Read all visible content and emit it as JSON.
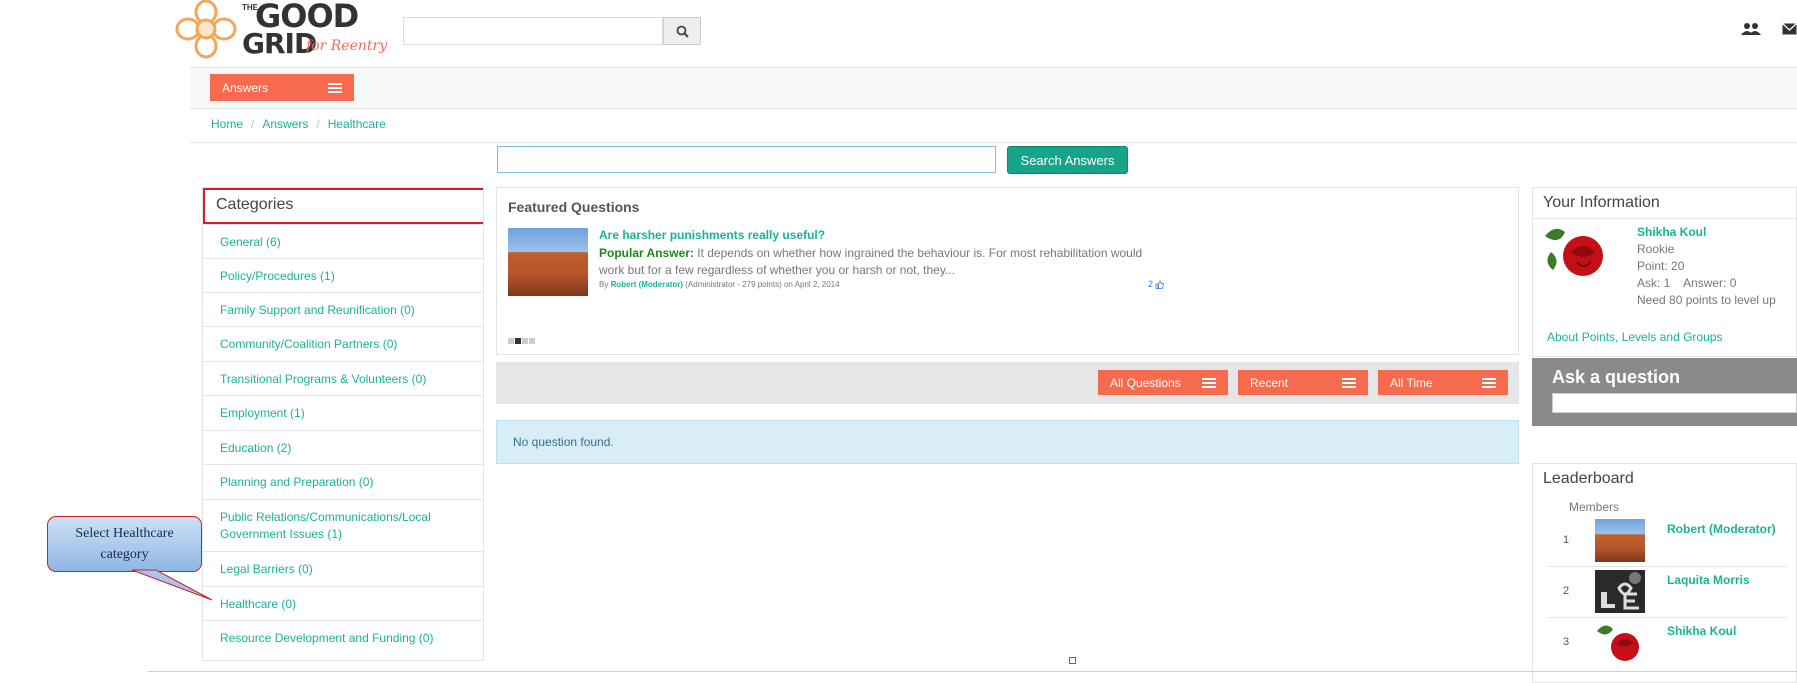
{
  "header": {
    "logo_line1": "GOOD",
    "logo_line2": "GRID",
    "logo_the": "THE",
    "logo_tagline": "for Reentry",
    "search_placeholder": "",
    "search_icon": "search-icon",
    "members_icon": "users-icon",
    "mail_icon": "envelope-icon"
  },
  "answers_menu": {
    "label": "Answers"
  },
  "breadcrumb": [
    "Home",
    "Answers",
    "Healthcare"
  ],
  "main_search": {
    "placeholder": "",
    "button_label": "Search Answers"
  },
  "categories": {
    "title": "Categories",
    "items": [
      "General (6)",
      "Policy/Procedures (1)",
      "Family Support and Reunification (0)",
      "Community/Coalition Partners (0)",
      "Transitional Programs & Volunteers (0)",
      "Employment (1)",
      "Education (2)",
      "Planning and Preparation (0)",
      "Public Relations/Communications/Local Government Issues (1)",
      "Legal Barriers (0)",
      "Healthcare (0)",
      "Resource Development and Funding (0)"
    ]
  },
  "callout": {
    "line1": "Select Healthcare",
    "line2": "category"
  },
  "featured": {
    "title": "Featured Questions",
    "question_title": "Are harsher punishments really useful?",
    "popular_label": "Popular Answer:",
    "answer_text": "It depends on whether how ingrained the behaviour is. For most rehabilitation would work but for a few regardless of whether you or harsh or not, they...",
    "by_label": "By",
    "author": "Robert (Moderator)",
    "author_meta": "(Administrator - 279 points)",
    "date": "on April 2, 2014",
    "likes": "2"
  },
  "filters": {
    "all_questions": "All Questions",
    "recent": "Recent",
    "all_time": "All Time"
  },
  "no_questions": "No question found.",
  "your_info": {
    "title": "Your Information",
    "name": "Shikha Koul",
    "rank": "Rookie",
    "points": "Point: 20",
    "ask_answer": "Ask: 1    Answer: 0",
    "need": "Need 80 points to level up",
    "about_link": "About Points, Levels and Groups"
  },
  "ask": {
    "title": "Ask a question",
    "placeholder": ""
  },
  "leaderboard": {
    "title": "Leaderboard",
    "members_label": "Members",
    "rows": [
      {
        "rank": "1",
        "name": "Robert (Moderator)"
      },
      {
        "rank": "2",
        "name": "Laquita Morris"
      },
      {
        "rank": "3",
        "name": "Shikha Koul"
      }
    ]
  },
  "colors": {
    "accent_orange": "#f66a4e",
    "accent_teal": "#1ab394",
    "callout_border": "#cc2229"
  }
}
